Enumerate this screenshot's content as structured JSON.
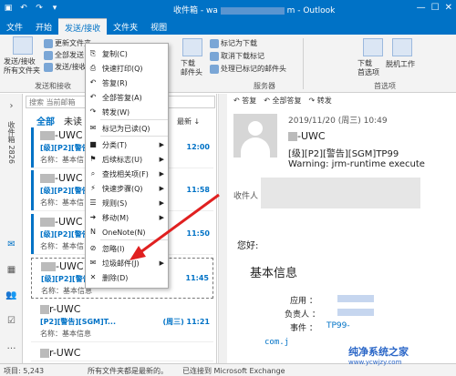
{
  "window": {
    "title": "收件箱 - wa… Outlook",
    "title_prefix": "收件箱 - wa",
    "title_suffix": "m - Outlook"
  },
  "tabs": [
    "文件",
    "开始",
    "发送/接收",
    "文件夹",
    "视图"
  ],
  "ribbon": {
    "send_receive_all": "发送/接收\n所有文件夹",
    "update_folder": "更新文件夹",
    "send_all": "全部发送",
    "send_receive_group": "发送/接收组",
    "group_send_receive_label": "发送和接收",
    "download_headers": "下载\n邮件头",
    "mark_to_download": "标记为下载",
    "unmark_download": "取消下载标记",
    "process_marked": "处理已标记的邮件头",
    "server_label": "服务器",
    "download_prefs": "下载\n首选项",
    "work_offline": "脱机工作",
    "preferences_label": "首选项"
  },
  "left_strip": {
    "folders_label": "收件箱 2826"
  },
  "list": {
    "search_placeholder": "搜索 当前邮箱",
    "filter_all": "全部",
    "filter_unread": "未读",
    "sort_label": "最新 ↓",
    "messages": [
      {
        "sender": "-UWC",
        "subject": "[级][P2][警告]",
        "time": "12:00",
        "preview": "名称：基本信"
      },
      {
        "sender": "-UWC",
        "subject": "[级][P2][警告]",
        "time": "11:58",
        "preview": "名称：基本信"
      },
      {
        "sender": "-UWC",
        "subject": "[级][P2][警告]",
        "time": "11:50",
        "preview": "名称：基本信"
      },
      {
        "sender": "-UWC",
        "subject": "[级][P2][警告]",
        "time": "11:45",
        "preview": "名称：基本信息"
      },
      {
        "sender": "r-UWC",
        "subject": "[P2][警告][SGM]T...",
        "time": "(周三) 11:21",
        "preview": "名称：基本信息"
      },
      {
        "sender": "r-UWC",
        "subject": "",
        "time": "",
        "preview": ""
      }
    ]
  },
  "context_menu": {
    "items": [
      {
        "label": "复制(C)",
        "icon": "copy-icon",
        "glyph": "⎘",
        "arrow": false
      },
      {
        "label": "快速打印(Q)",
        "icon": "print-icon",
        "glyph": "⎙",
        "arrow": false
      },
      {
        "label": "答复(R)",
        "icon": "reply-icon",
        "glyph": "↶",
        "arrow": false
      },
      {
        "label": "全部答复(A)",
        "icon": "reply-all-icon",
        "glyph": "↶",
        "arrow": false
      },
      {
        "label": "转发(W)",
        "icon": "forward-icon",
        "glyph": "↷",
        "arrow": false
      },
      {
        "label": "标记为已读(Q)",
        "icon": "mark-read-icon",
        "glyph": "✉",
        "arrow": false
      },
      {
        "label": "分类(T)",
        "icon": "category-icon",
        "glyph": "■",
        "arrow": true
      },
      {
        "label": "后续标志(U)",
        "icon": "flag-icon",
        "glyph": "⚑",
        "arrow": true
      },
      {
        "label": "查找相关项(F)",
        "icon": "find-icon",
        "glyph": "⌕",
        "arrow": true
      },
      {
        "label": "快速步骤(Q)",
        "icon": "quick-steps-icon",
        "glyph": "⚡",
        "arrow": true
      },
      {
        "label": "规则(S)",
        "icon": "rules-icon",
        "glyph": "☰",
        "arrow": true
      },
      {
        "label": "移动(M)",
        "icon": "move-icon",
        "glyph": "➜",
        "arrow": true
      },
      {
        "label": "OneNote(N)",
        "icon": "onenote-icon",
        "glyph": "N",
        "arrow": false
      },
      {
        "label": "忽略(I)",
        "icon": "ignore-icon",
        "glyph": "⊘",
        "arrow": false
      },
      {
        "label": "垃圾邮件(J)",
        "icon": "junk-icon",
        "glyph": "✉",
        "arrow": true
      },
      {
        "label": "删除(D)",
        "icon": "delete-icon",
        "glyph": "✕",
        "arrow": false
      }
    ]
  },
  "reading": {
    "reply": "答复",
    "reply_all": "全部答复",
    "forward": "转发",
    "date": "2019/11/20 (周三) 10:49",
    "sender": "-UWC",
    "subject": "[级][P2][警告][SGM]TP99",
    "warning": "Warning: jrm-runtime execute",
    "recipient_label": "收件人",
    "greeting": "您好:",
    "section_title": "基本信息",
    "app_label": "应用 ：",
    "owner_label": "负责人 ：",
    "event_label": "事件 ：",
    "event_value": "TP99-",
    "link_text": "com.j"
  },
  "status": {
    "items": "项目: 5,243",
    "all_updated": "所有文件夹都是最新的。",
    "connected": "已连接到 Microsoft Exchange"
  },
  "watermark": {
    "title": "纯净系统之家",
    "sub": "www.ycwjzy.com"
  },
  "colors": {
    "accent": "#0072c6",
    "arrow": "#e02020"
  }
}
